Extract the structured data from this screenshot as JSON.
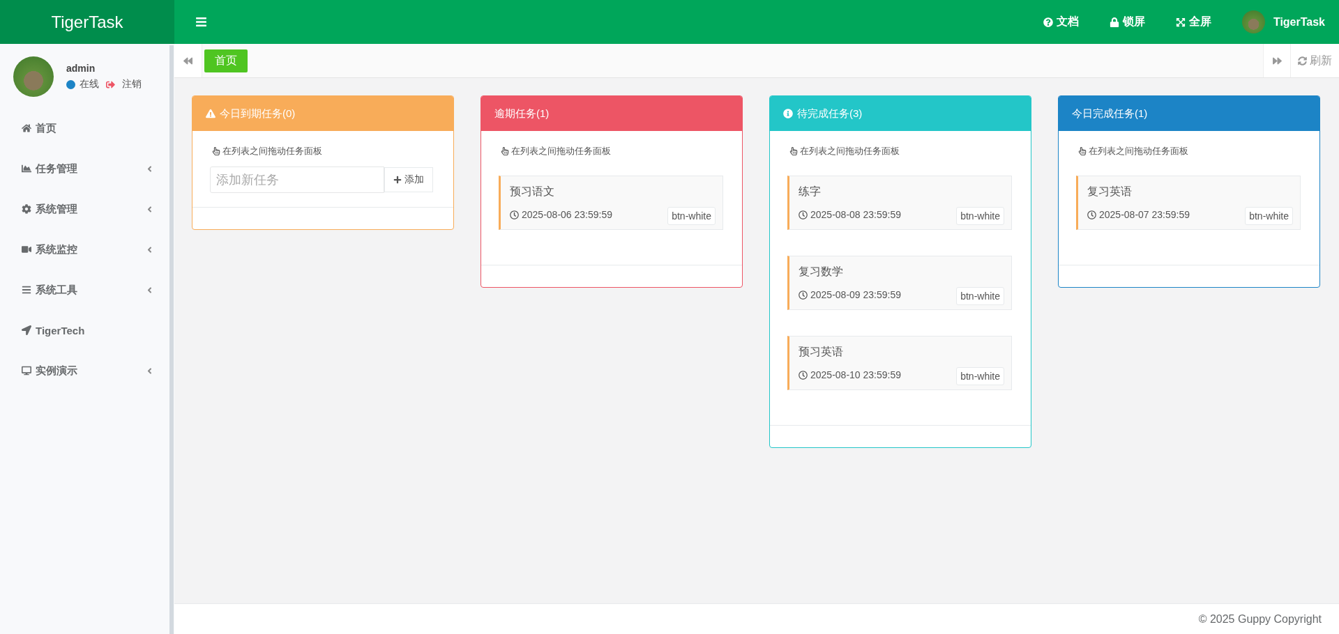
{
  "brand": {
    "name": "TigerTask"
  },
  "topbar": {
    "links": [
      {
        "label": "文档"
      },
      {
        "label": "锁屏"
      },
      {
        "label": "全屏"
      }
    ],
    "user_name": "TigerTask"
  },
  "profile": {
    "name": "admin",
    "status": {
      "label": "在线",
      "color": "#1c84c6"
    },
    "logout": "注销"
  },
  "sidebar": {
    "items": [
      {
        "label": "首页",
        "submenu": false
      },
      {
        "label": "任务管理",
        "submenu": true
      },
      {
        "label": "系统管理",
        "submenu": true
      },
      {
        "label": "系统监控",
        "submenu": true
      },
      {
        "label": "系统工具",
        "submenu": true
      },
      {
        "label": "TigerTech",
        "submenu": false
      },
      {
        "label": "实例演示",
        "submenu": true
      }
    ]
  },
  "tabs": [
    {
      "label": "首页",
      "selected": true
    }
  ],
  "refresh": "刷新",
  "columns": [
    {
      "kind": "due",
      "title": "今日到期任务(0)",
      "color": "#f8ac59",
      "hint": "在列表之间拖动任务面板",
      "add": {
        "placeholder": "添加新任务",
        "button": "添加"
      }
    },
    {
      "kind": "overdue",
      "title": "逾期任务(1)",
      "color": "#ed5565",
      "hint": "在列表之间拖动任务面板",
      "tasks": [
        {
          "title": "预习语文",
          "date": "2025-08-06 23:59:59",
          "tag": "btn-white"
        }
      ]
    },
    {
      "kind": "pending",
      "title": "待完成任务(3)",
      "color": "#23c6c8",
      "hint": "在列表之间拖动任务面板",
      "tasks": [
        {
          "title": "练字",
          "date": "2025-08-08 23:59:59",
          "tag": "btn-white"
        },
        {
          "title": "复习数学",
          "date": "2025-08-09 23:59:59",
          "tag": "btn-white"
        },
        {
          "title": "预习英语",
          "date": "2025-08-10 23:59:59",
          "tag": "btn-white"
        }
      ]
    },
    {
      "kind": "done",
      "title": "今日完成任务(1)",
      "color": "#1c84c6",
      "hint": "在列表之间拖动任务面板",
      "tasks": [
        {
          "title": "复习英语",
          "date": "2025-08-07 23:59:59",
          "tag": "btn-white"
        }
      ]
    }
  ],
  "footer": "© 2025 Guppy Copyright"
}
